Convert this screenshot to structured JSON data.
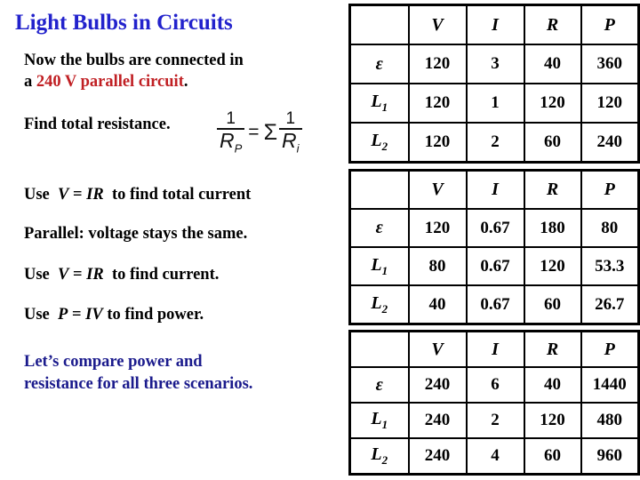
{
  "slide": {
    "title": "Light Bulbs in Circuits",
    "intro": {
      "line1_plain": "Now the bulbs are connected in",
      "line2_prefix": "a ",
      "line2_red": "240 V parallel circuit",
      "line2_suffix": "."
    },
    "find_resistance": "Find total resistance.",
    "formula": {
      "numerator": "1",
      "denominator_symbol": "R",
      "denominator_subscript": "P",
      "equals": "=",
      "sigma": "Σ",
      "rhs_numerator": "1",
      "rhs_denominator_symbol": "R",
      "rhs_denominator_subscript": "i"
    },
    "steps": [
      {
        "prefix": "Use",
        "equation_left": "V",
        "equation_op": "=",
        "equation_right": "IR",
        "suffix": "to find total current"
      },
      {
        "plain": "Parallel: voltage stays the same."
      },
      {
        "prefix": "Use",
        "equation_left": "V",
        "equation_op": "=",
        "equation_right": "IR",
        "suffix": "to find current."
      },
      {
        "prefix": "Use",
        "equation_left": "P",
        "equation_op": "=",
        "equation_right": "IV",
        "suffix": "to find power."
      }
    ],
    "conclusion": {
      "line1": "Let’s compare power and",
      "line2": "resistance for all three scenarios."
    }
  },
  "colors": {
    "title_blue": "#2222cc",
    "body_red": "#c01f23",
    "conclusion_navy": "#1a1a8c",
    "table_red": "#b41f24",
    "table_blue": "#1414a0",
    "text_black": "#000000"
  },
  "tables": [
    {
      "id": "table-1",
      "headers": [
        "",
        "V",
        "I",
        "R",
        "P"
      ],
      "rows": [
        {
          "label": "ε",
          "label_sub": "",
          "cells": [
            {
              "value": "120",
              "color": "black"
            },
            {
              "value": "3",
              "color": "black"
            },
            {
              "value": "40",
              "color": "black"
            },
            {
              "value": "360",
              "color": "black"
            }
          ]
        },
        {
          "label": "L",
          "label_sub": "1",
          "cells": [
            {
              "value": "120",
              "color": "black"
            },
            {
              "value": "1",
              "color": "black"
            },
            {
              "value": "120",
              "color": "blue"
            },
            {
              "value": "120",
              "color": "red"
            }
          ]
        },
        {
          "label": "L",
          "label_sub": "2",
          "cells": [
            {
              "value": "120",
              "color": "black"
            },
            {
              "value": "2",
              "color": "black"
            },
            {
              "value": "60",
              "color": "blue"
            },
            {
              "value": "240",
              "color": "red"
            }
          ]
        }
      ]
    },
    {
      "id": "table-2",
      "headers": [
        "",
        "V",
        "I",
        "R",
        "P"
      ],
      "rows": [
        {
          "label": "ε",
          "label_sub": "",
          "cells": [
            {
              "value": "120",
              "color": "black"
            },
            {
              "value": "0.67",
              "color": "black"
            },
            {
              "value": "180",
              "color": "black"
            },
            {
              "value": "80",
              "color": "black"
            }
          ]
        },
        {
          "label": "L",
          "label_sub": "1",
          "cells": [
            {
              "value": "80",
              "color": "black"
            },
            {
              "value": "0.67",
              "color": "black"
            },
            {
              "value": "120",
              "color": "blue"
            },
            {
              "value": "53.3",
              "color": "red"
            }
          ]
        },
        {
          "label": "L",
          "label_sub": "2",
          "cells": [
            {
              "value": "40",
              "color": "black"
            },
            {
              "value": "0.67",
              "color": "black"
            },
            {
              "value": "60",
              "color": "blue"
            },
            {
              "value": "26.7",
              "color": "red"
            }
          ]
        }
      ]
    },
    {
      "id": "table-3",
      "headers": [
        "",
        "V",
        "I",
        "R",
        "P"
      ],
      "rows": [
        {
          "label": "ε",
          "label_sub": "",
          "cells": [
            {
              "value": "240",
              "color": "black"
            },
            {
              "value": "6",
              "color": "red"
            },
            {
              "value": "40",
              "color": "red"
            },
            {
              "value": "1440",
              "color": "red"
            }
          ]
        },
        {
          "label": "L",
          "label_sub": "1",
          "cells": [
            {
              "value": "240",
              "color": "red"
            },
            {
              "value": "2",
              "color": "red"
            },
            {
              "value": "120",
              "color": "blue"
            },
            {
              "value": "480",
              "color": "red"
            }
          ]
        },
        {
          "label": "L",
          "label_sub": "2",
          "cells": [
            {
              "value": "240",
              "color": "red"
            },
            {
              "value": "4",
              "color": "red"
            },
            {
              "value": "60",
              "color": "blue"
            },
            {
              "value": "960",
              "color": "red"
            }
          ]
        }
      ]
    }
  ]
}
